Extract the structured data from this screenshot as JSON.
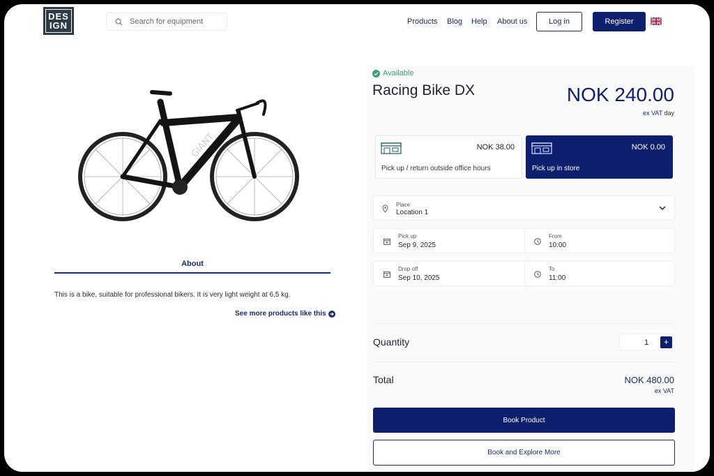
{
  "header": {
    "logo_lines": [
      "DES",
      "IGN"
    ],
    "search_placeholder": "Search for equipment",
    "nav": [
      "Products",
      "Blog",
      "Help",
      "About us"
    ],
    "login_label": "Log in",
    "register_label": "Register",
    "language_icon": "uk-flag-icon"
  },
  "product": {
    "availability": "Available",
    "title": "Racing Bike DX",
    "price": "NOK 240.00",
    "price_vat": "ex VAT",
    "price_unit": "day",
    "about_tab": "About",
    "description": "This is a bike, suitable for professional bikers. It is very light weight at 6,5 kg.",
    "see_more": "See more products like this"
  },
  "pickup_options": [
    {
      "price": "NOK 38.00",
      "label": "Pick up / return outside office hours",
      "selected": false
    },
    {
      "price": "NOK 0.00",
      "label": "Pick up in store",
      "selected": true
    }
  ],
  "place": {
    "label": "Place",
    "value": "Location 1"
  },
  "pickup": {
    "date_label": "Pick up",
    "date": "Sep 9, 2025",
    "time_label": "From",
    "time": "10:00"
  },
  "dropoff": {
    "date_label": "Drop off",
    "date": "Sep 10, 2025",
    "time_label": "To",
    "time": "11:00"
  },
  "quantity": {
    "label": "Quantity",
    "value": "1",
    "plus": "+"
  },
  "total": {
    "label": "Total",
    "value": "NOK 480.00",
    "vat": "ex VAT"
  },
  "actions": {
    "book": "Book Product",
    "explore": "Book and Explore More"
  },
  "colors": {
    "brand": "#0e1f6e",
    "available": "#3aa072"
  }
}
